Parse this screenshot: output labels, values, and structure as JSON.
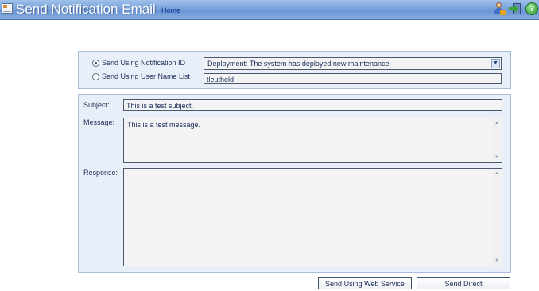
{
  "header": {
    "title": "Send Notification Email",
    "home_link": "Home",
    "icons": [
      "app-icon",
      "user-icon",
      "exit-icon",
      "help-icon"
    ],
    "help_glyph": "?"
  },
  "send_options": {
    "by_notification_id_label": "Send Using Notification ID",
    "by_user_list_label": "Send Using User Name List",
    "selected_option": "notification_id",
    "notification_id_value": "Deployment: The system has deployed new maintenance.",
    "user_name_list_value": "tleuthold"
  },
  "form": {
    "subject_label": "Subject:",
    "subject_value": "This is a test subject.",
    "message_label": "Message:",
    "message_value": "This is a test message.",
    "response_label": "Response:",
    "response_value": ""
  },
  "actions": {
    "web_service_label": "Send Using Web Service",
    "direct_label": "Send Direct"
  },
  "colors": {
    "titlebar": "#7aa3dc",
    "panel_bg": "#e9eff8",
    "panel_border": "#a9bcd8",
    "text": "#1c2e55"
  }
}
